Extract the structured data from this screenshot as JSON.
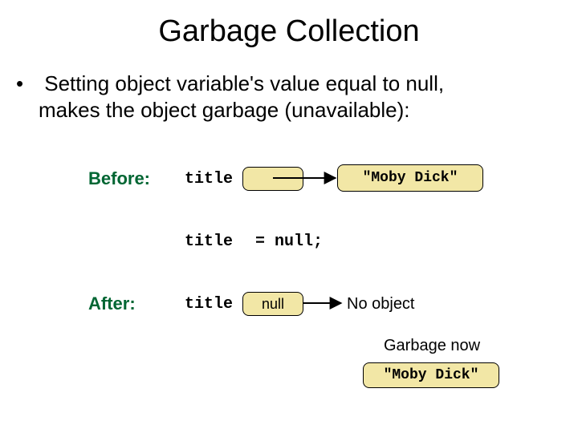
{
  "title": "Garbage Collection",
  "bullet": {
    "line1": "Setting object variable's value equal to null,",
    "line2": "makes the object garbage (unavailable):"
  },
  "before": {
    "label": "Before:",
    "var": "title",
    "value": "\"Moby Dick\""
  },
  "assignment": {
    "var": "title",
    "code": " = null;"
  },
  "after": {
    "label": "After:",
    "var": "title",
    "box": "null",
    "no_object": "No object",
    "garbage_now": "Garbage now",
    "garbage_val": "\"Moby Dick\""
  }
}
